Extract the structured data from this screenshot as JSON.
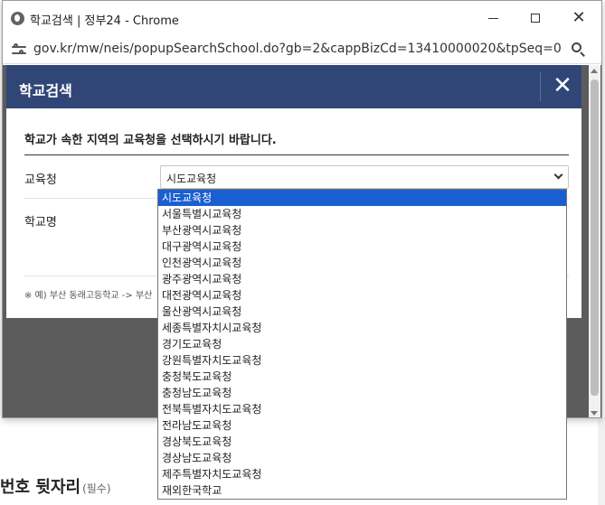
{
  "window": {
    "title": "학교검색 | 정부24 - Chrome",
    "url": "gov.kr/mw/neis/popupSearchSchool.do?gb=2&cappBizCd=13410000020&tpSeq=01&pTy..."
  },
  "modal": {
    "title": "학교검색",
    "close_label": "✕",
    "instruction": "학교가 속한 지역의 교육청을 선택하시기 바랍니다.",
    "edu_label": "교육청",
    "school_label": "학교명",
    "select_value": "시도교육청",
    "example_text": "※ 예) 부산 동래고등학교 -> 부산"
  },
  "dropdown": {
    "options": [
      "시도교육청",
      "서울특별시교육청",
      "부산광역시교육청",
      "대구광역시교육청",
      "인천광역시교육청",
      "광주광역시교육청",
      "대전광역시교육청",
      "울산광역시교육청",
      "세종특별자치시교육청",
      "경기도교육청",
      "강원특별자치도교육청",
      "충청북도교육청",
      "충청남도교육청",
      "전북특별자치도교육청",
      "전라남도교육청",
      "경상북도교육청",
      "경상남도교육청",
      "제주특별자치도교육청",
      "재외한국학교"
    ],
    "selected_index": 0
  },
  "background": {
    "section_title": "번호 뒷자리",
    "required_tag": "(필수)"
  },
  "colors": {
    "modal_header": "#304676",
    "selected_option": "#1a5fd0"
  }
}
